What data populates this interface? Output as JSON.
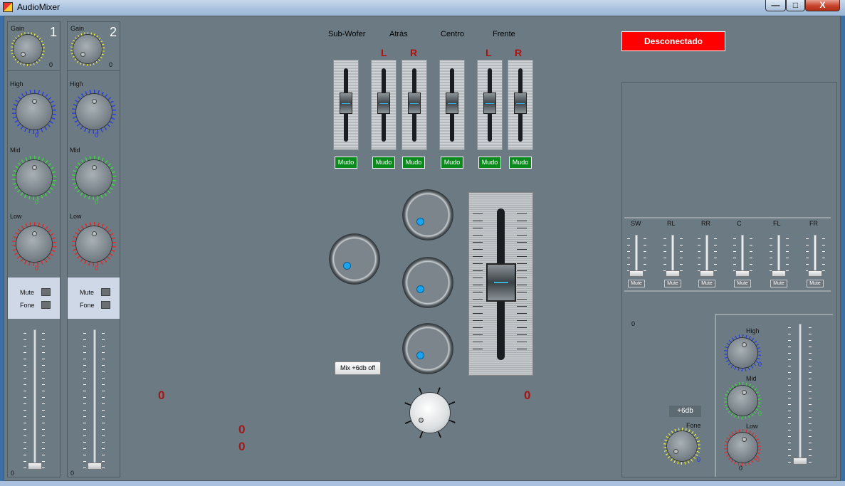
{
  "window": {
    "title": "AudioMixer",
    "minimize": "—",
    "maximize": "□",
    "close": "X"
  },
  "colors": {
    "client_bg": "#6c7a84",
    "disconnected_bg": "#ff0000",
    "mute_green": "#0a8a1c",
    "accent_blue": "#1aa3ee"
  },
  "channels": [
    {
      "number": "1",
      "gain_label": "Gain",
      "gain_value": "0",
      "high_label": "High",
      "high_value": "0",
      "mid_label": "Mid",
      "mid_value": "0",
      "low_label": "Low",
      "low_value": "0",
      "mute_label": "Mute",
      "fone_label": "Fone",
      "fader_value": "0"
    },
    {
      "number": "2",
      "gain_label": "Gain",
      "gain_value": "0",
      "high_label": "High",
      "high_value": "0",
      "mid_label": "Mid",
      "mid_value": "0",
      "low_label": "Low",
      "low_value": "0",
      "mute_label": "Mute",
      "fone_label": "Fone",
      "fader_value": "0"
    }
  ],
  "outputs": {
    "group_labels": {
      "sub": "Sub-Wofer",
      "rear": "Atrás",
      "center": "Centro",
      "front": "Frente"
    },
    "lr": {
      "rear_l": "L",
      "rear_r": "R",
      "front_l": "L",
      "front_r": "R"
    },
    "mute_label": "Mudo"
  },
  "mix_button": "Mix +6db off",
  "status": {
    "connection": "Desconectado"
  },
  "readouts": {
    "left_level": "0",
    "right_level": "0",
    "mid_a": "0",
    "mid_b": "0"
  },
  "monitor": {
    "channels": [
      "SW",
      "RL",
      "RR",
      "C",
      "FL",
      "FR"
    ],
    "mute_label": "Mute",
    "top_value": "0",
    "plus6_label": "+6db",
    "fone_label": "Fone",
    "fone_value": "0",
    "high_label": "High",
    "high_value": "0",
    "mid_label": "Mid",
    "mid_value": "0",
    "low_label": "Low",
    "low_value": "0",
    "bottom_value": "0"
  }
}
